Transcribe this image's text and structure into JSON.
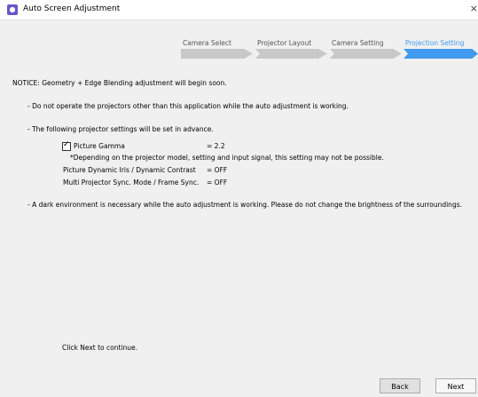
{
  "window": {
    "title": "Auto Screen Adjustment",
    "close_glyph": "×",
    "icon": "app-icon"
  },
  "steps": [
    {
      "label": "Camera Select",
      "state": "done"
    },
    {
      "label": "Projector Layout",
      "state": "done"
    },
    {
      "label": "Camera Setting",
      "state": "done"
    },
    {
      "label": "Projection Setting",
      "state": "active"
    }
  ],
  "colors": {
    "accent": "#3f9af0",
    "step_inactive": "#c8c8c8"
  },
  "content": {
    "notice": "NOTICE: Geometry + Edge Blending adjustment will begin soon.",
    "line1": "- Do not operate the projectors other than this application while the auto adjustment is working.",
    "line2": "- The following projector settings will be set in advance.",
    "settings": [
      {
        "label": "Picture Gamma",
        "value": "= 2.2",
        "checked": true
      },
      {
        "note": "*Depending on the projector model, setting and input signal, this setting may not be possible."
      },
      {
        "label": "Picture Dynamic Iris / Dynamic Contrast",
        "value": "= OFF"
      },
      {
        "label": "Multi Projector Sync. Mode / Frame Sync.",
        "value": "= OFF"
      }
    ],
    "line3": "- A dark environment is necessary while the auto adjustment is working. Please do not change the brightness of the surroundings.",
    "footer": "Click Next to continue."
  },
  "buttons": {
    "back": "Back",
    "next": "Next"
  }
}
